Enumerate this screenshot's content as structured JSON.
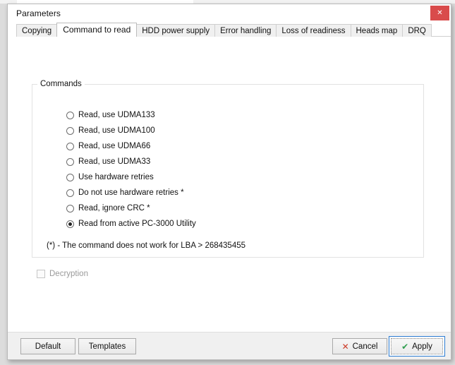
{
  "window": {
    "title": "Parameters",
    "close_label": "✕",
    "close_icon": "close-icon"
  },
  "tabs": [
    {
      "label": "Copying",
      "active": false
    },
    {
      "label": "Command to read",
      "active": true
    },
    {
      "label": "HDD power supply",
      "active": false
    },
    {
      "label": "Error handling",
      "active": false
    },
    {
      "label": "Loss of readiness",
      "active": false
    },
    {
      "label": "Heads map",
      "active": false
    },
    {
      "label": "DRQ",
      "active": false
    }
  ],
  "commands_group": {
    "legend": "Commands",
    "options": [
      {
        "label": "Read, use UDMA133",
        "checked": false
      },
      {
        "label": "Read, use UDMA100",
        "checked": false
      },
      {
        "label": "Read, use UDMA66",
        "checked": false
      },
      {
        "label": "Read, use UDMA33",
        "checked": false
      },
      {
        "label": "Use hardware retries",
        "checked": false
      },
      {
        "label": "Do not use hardware retries *",
        "checked": false
      },
      {
        "label": "Read, ignore CRC *",
        "checked": false
      },
      {
        "label": "Read from active PC-3000 Utility",
        "checked": true
      }
    ],
    "footnote": "(*) - The command does not work for LBA > 268435455"
  },
  "decryption": {
    "label": "Decryption",
    "checked": false,
    "disabled": true
  },
  "footer": {
    "default_label": "Default",
    "templates_label": "Templates",
    "cancel_label": "Cancel",
    "cancel_icon": "✕",
    "apply_label": "Apply",
    "apply_icon": "✔"
  },
  "colors": {
    "close_button": "#d94b4b",
    "cancel_icon": "#cc3b28",
    "apply_icon": "#2f9e4f",
    "focus_border": "#2b7cd3",
    "dialog_background": "#f0f0f0",
    "page_background": "#ffffff"
  }
}
